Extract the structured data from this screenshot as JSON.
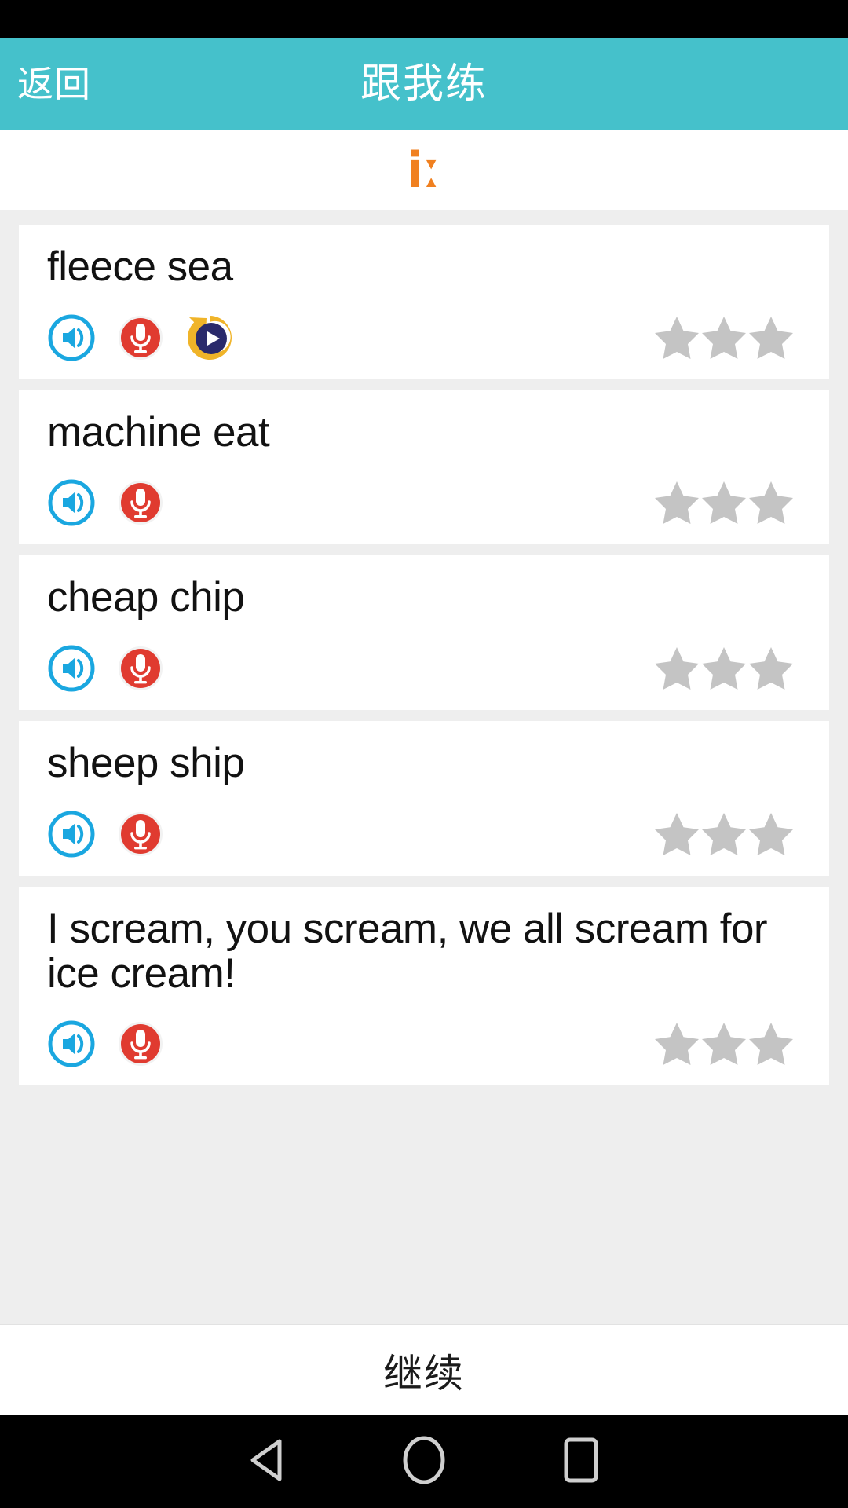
{
  "status_bar": {
    "background": "#000000"
  },
  "app_bar": {
    "back_label": "返回",
    "title": "跟我练",
    "background": "#45c1cb",
    "text_color": "#ffffff"
  },
  "phoneme": {
    "symbol": "iː",
    "color": "#f08020"
  },
  "theme": {
    "page_background": "#eeeeee",
    "card_background": "#ffffff",
    "speaker_icon_color": "#1aa7e0",
    "mic_icon_color": "#e03b30",
    "replay_ring_color": "#f0b429",
    "replay_center_color": "#2a2a6b",
    "star_empty_color": "#c4c4c4"
  },
  "practice_items": [
    {
      "text": "fleece sea",
      "speaker_icon": "speaker-icon",
      "record_icon": "microphone-icon",
      "replay_icon": "replay-play-icon",
      "has_replay": true,
      "stars_total": 3,
      "stars_filled": 0
    },
    {
      "text": "machine eat",
      "speaker_icon": "speaker-icon",
      "record_icon": "microphone-icon",
      "replay_icon": "replay-play-icon",
      "has_replay": false,
      "stars_total": 3,
      "stars_filled": 0
    },
    {
      "text": "cheap chip",
      "speaker_icon": "speaker-icon",
      "record_icon": "microphone-icon",
      "replay_icon": "replay-play-icon",
      "has_replay": false,
      "stars_total": 3,
      "stars_filled": 0
    },
    {
      "text": "sheep ship",
      "speaker_icon": "speaker-icon",
      "record_icon": "microphone-icon",
      "replay_icon": "replay-play-icon",
      "has_replay": false,
      "stars_total": 3,
      "stars_filled": 0
    },
    {
      "text": "I scream, you scream, we all scream for ice cream!",
      "speaker_icon": "speaker-icon",
      "record_icon": "microphone-icon",
      "replay_icon": "replay-play-icon",
      "has_replay": false,
      "stars_total": 3,
      "stars_filled": 0
    }
  ],
  "continue_bar": {
    "label": "继续"
  },
  "nav_bar": {
    "back": "nav-back-icon",
    "home": "nav-home-icon",
    "recents": "nav-recents-icon"
  }
}
